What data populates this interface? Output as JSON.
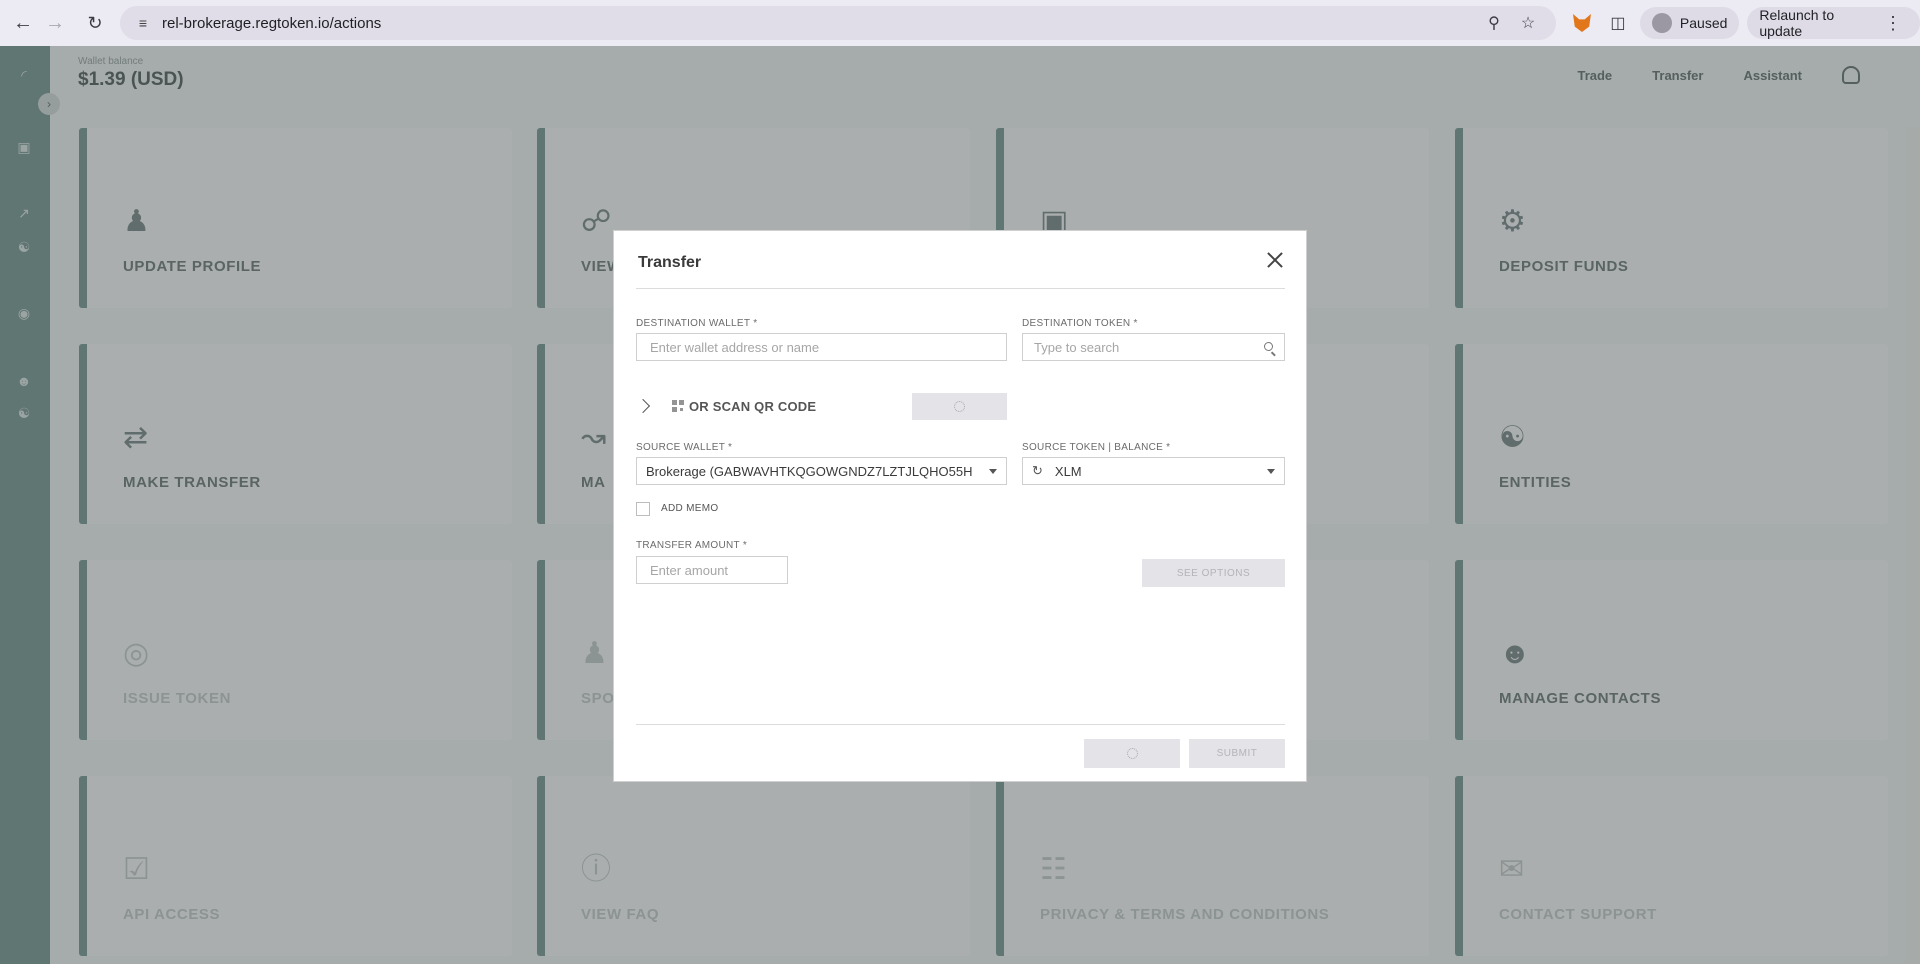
{
  "browser": {
    "url": "rel-brokerage.regtoken.io/actions",
    "profile_status": "Paused",
    "relaunch_label": "Relaunch to update"
  },
  "app": {
    "wallet_label": "Wallet balance",
    "wallet_balance": "$1.39 (USD)",
    "nav": [
      "Trade",
      "Transfer",
      "Assistant"
    ],
    "tiles": [
      {
        "label": "UPDATE PROFILE",
        "icon": "user-add-icon"
      },
      {
        "label": "VIEW",
        "icon": "network-icon"
      },
      {
        "label": "",
        "icon": "wallet-add-icon"
      },
      {
        "label": "DEPOSIT FUNDS",
        "icon": "safe-icon"
      },
      {
        "label": "MAKE TRANSFER",
        "icon": "transfer-arrows-icon"
      },
      {
        "label": "MA",
        "icon": "chart-icon"
      },
      {
        "label": "",
        "icon": ""
      },
      {
        "label": "ENTITIES",
        "icon": "handshake-icon"
      },
      {
        "label": "ISSUE TOKEN",
        "icon": "token-icon"
      },
      {
        "label": "SPO",
        "icon": "user-icon"
      },
      {
        "label": "",
        "icon": ""
      },
      {
        "label": "MANAGE CONTACTS",
        "icon": "contacts-icon"
      },
      {
        "label": "API ACCESS",
        "icon": "api-icon"
      },
      {
        "label": "VIEW FAQ",
        "icon": "question-icon"
      },
      {
        "label": "PRIVACY & TERMS AND CONDITIONS",
        "icon": "document-icon"
      },
      {
        "label": "CONTACT SUPPORT",
        "icon": "chat-icon"
      }
    ]
  },
  "modal": {
    "title": "Transfer",
    "destination_wallet": {
      "label": "DESTINATION WALLET *",
      "placeholder": "Enter wallet address or name"
    },
    "destination_token": {
      "label": "DESTINATION TOKEN *",
      "placeholder": "Type to search"
    },
    "scan_label": "OR SCAN QR CODE",
    "source_wallet": {
      "label": "SOURCE WALLET *",
      "value": "Brokerage (GABWAVHTKQGOWGNDZ7LZTJLQHO55H"
    },
    "source_token": {
      "label": "SOURCE TOKEN | BALANCE *",
      "value": "XLM"
    },
    "memo_label": "ADD MEMO",
    "amount": {
      "label": "TRANSFER AMOUNT *",
      "placeholder": "Enter amount"
    },
    "see_options_label": "SEE OPTIONS",
    "submit_label": "SUBMIT"
  }
}
